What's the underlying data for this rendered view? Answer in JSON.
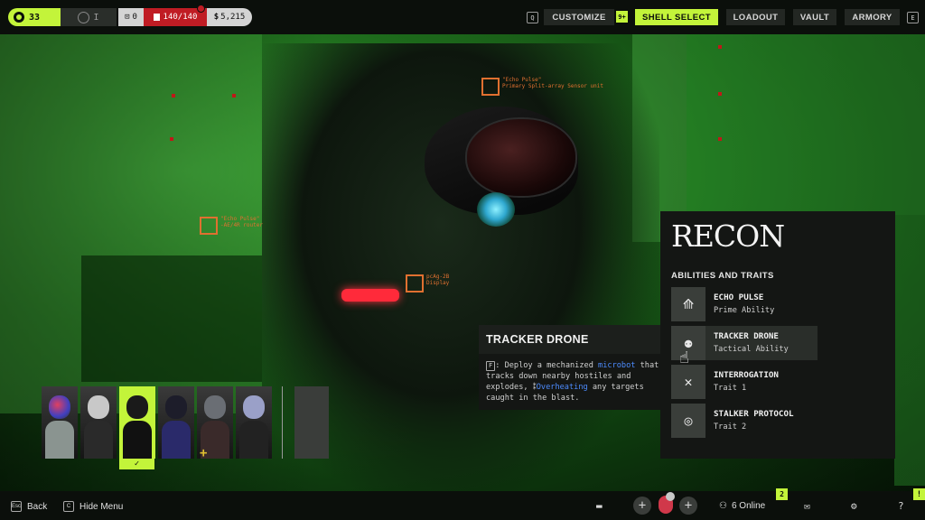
{
  "colors": {
    "accent": "#c3f43a",
    "panel": "#141614",
    "health": "#c01c24",
    "scene_green": "#2d8c2a",
    "label_orange": "#e07030",
    "link_blue": "#4d8cff"
  },
  "topbar": {
    "level": "33",
    "rank_numeral": "I",
    "boxes": "0",
    "health": "140/140",
    "credits": "5,215",
    "left_key_hint": "Q",
    "right_key_hint": "E",
    "notification_count": "9+",
    "nav": [
      {
        "label": "CUSTOMIZE",
        "active": false
      },
      {
        "label": "SHELL SELECT",
        "active": true
      },
      {
        "label": "LOADOUT",
        "active": false
      },
      {
        "label": "VAULT",
        "active": false
      },
      {
        "label": "ARMORY",
        "active": false
      }
    ]
  },
  "scene": {
    "labels": [
      {
        "text": "\"Echo Pulse\"\nPrimary Split-array Sensor unit"
      },
      {
        "text": "\"Echo Pulse\"\n-AE/4R router"
      },
      {
        "text": "pcAg-2B\nDisplay"
      }
    ]
  },
  "roster": {
    "selected_index": 2,
    "selected_mark": "✓",
    "plus_mark": "+"
  },
  "tooltip": {
    "title": "TRACKER DRONE",
    "key": "F",
    "text_before": ": Deploy a mechanized ",
    "highlight1": "microbot",
    "text_middle": " that tracks down nearby hostiles and explodes, ",
    "highlight2": "Overheating",
    "text_after": " any targets caught in the blast."
  },
  "recon": {
    "title": "RECON",
    "abilities_heading": "ABILITIES AND TRAITS",
    "abilities": [
      {
        "name": "ECHO PULSE",
        "type": "Prime Ability",
        "icon": "echo-pulse-icon",
        "active": false
      },
      {
        "name": "TRACKER DRONE",
        "type": "Tactical Ability",
        "icon": "tracker-drone-icon",
        "active": true
      },
      {
        "name": "INTERROGATION",
        "type": "Trait 1",
        "icon": "interrogation-icon",
        "active": false
      },
      {
        "name": "STALKER PROTOCOL",
        "type": "Trait 2",
        "icon": "stalker-protocol-icon",
        "active": false
      }
    ]
  },
  "bottombar": {
    "back_key": "Esc",
    "back_label": "Back",
    "hide_key": "C",
    "hide_label": "Hide Menu",
    "online_label": "6 Online",
    "online_badge": "2",
    "alert_badge": "!",
    "help_label": "?"
  }
}
